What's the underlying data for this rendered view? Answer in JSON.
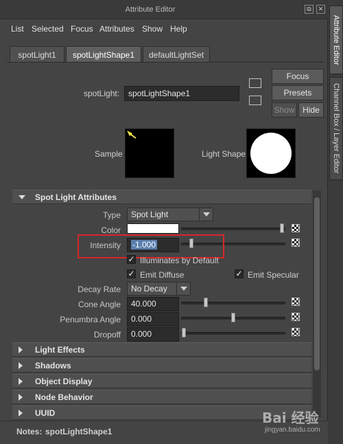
{
  "window": {
    "title": "Attribute Editor",
    "restore_glyph": "⧉",
    "close_glyph": "✕"
  },
  "menu": [
    "List",
    "Selected",
    "Focus",
    "Attributes",
    "Show",
    "Help"
  ],
  "tabs": [
    {
      "label": "spotLight1",
      "active": false
    },
    {
      "label": "spotLightShape1",
      "active": true
    },
    {
      "label": "defaultLightSet",
      "active": false
    }
  ],
  "node": {
    "label": "spotLight:",
    "value": "spotLightShape1"
  },
  "side_buttons": {
    "focus": "Focus",
    "presets": "Presets",
    "show": "Show",
    "hide": "Hide"
  },
  "preview": {
    "sample_label": "Sample",
    "shape_label": "Light Shape"
  },
  "sections": {
    "spot": "Spot Light Attributes",
    "collapsed": [
      "Light Effects",
      "Shadows",
      "Object Display",
      "Node Behavior",
      "UUID"
    ]
  },
  "attrs": {
    "type": {
      "label": "Type",
      "value": "Spot Light"
    },
    "color": {
      "label": "Color",
      "swatch": "#ffffff"
    },
    "intensity": {
      "label": "Intensity",
      "value": "-1.000"
    },
    "illuminates": {
      "label": "Illuminates by Default",
      "checked": true
    },
    "emit_diffuse": {
      "label": "Emit Diffuse",
      "checked": true
    },
    "emit_specular": {
      "label": "Emit Specular",
      "checked": true
    },
    "decay": {
      "label": "Decay Rate",
      "value": "No Decay"
    },
    "cone": {
      "label": "Cone Angle",
      "value": "40.000"
    },
    "penumbra": {
      "label": "Penumbra Angle",
      "value": "0.000"
    },
    "dropoff": {
      "label": "Dropoff",
      "value": "0.000"
    }
  },
  "notes": {
    "label": "Notes:",
    "value": "spotLightShape1"
  },
  "dock_tabs": [
    "Attribute Editor",
    "Channel Box / Layer Editor"
  ],
  "watermark": {
    "line1": "Bai 经验",
    "line2": "jingyan.baidu.com"
  },
  "colors": {
    "highlight": "#d8262b",
    "selection": "#5b7fae"
  },
  "icons": [
    "restore-icon",
    "close-icon",
    "input-connection-icon",
    "output-connection-icon",
    "map-button-icon",
    "expand-triangle-icon",
    "collapse-triangle-icon",
    "dropdown-arrow-icon",
    "checkbox-check-icon",
    "spotlight-icon"
  ]
}
